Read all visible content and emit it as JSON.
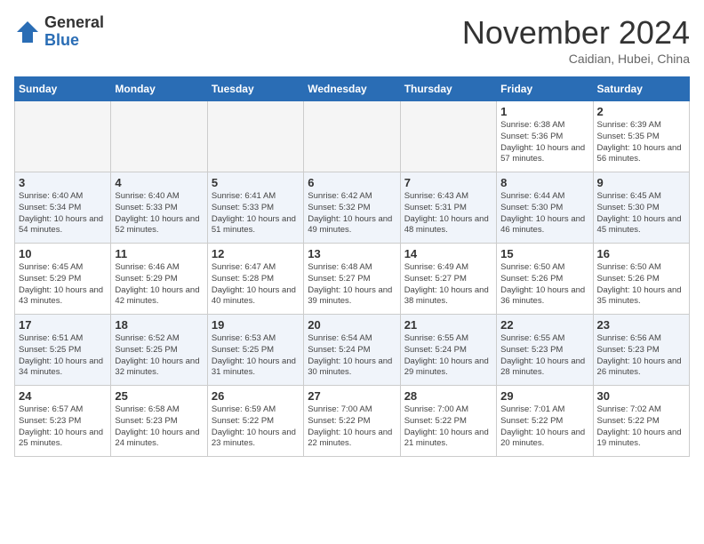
{
  "logo": {
    "general": "General",
    "blue": "Blue",
    "icon_color": "#2a6db5"
  },
  "header": {
    "month_year": "November 2024",
    "location": "Caidian, Hubei, China"
  },
  "weekdays": [
    "Sunday",
    "Monday",
    "Tuesday",
    "Wednesday",
    "Thursday",
    "Friday",
    "Saturday"
  ],
  "weeks": [
    [
      {
        "day": "",
        "empty": true
      },
      {
        "day": "",
        "empty": true
      },
      {
        "day": "",
        "empty": true
      },
      {
        "day": "",
        "empty": true
      },
      {
        "day": "",
        "empty": true
      },
      {
        "day": "1",
        "sunrise": "Sunrise: 6:38 AM",
        "sunset": "Sunset: 5:36 PM",
        "daylight": "Daylight: 10 hours and 57 minutes."
      },
      {
        "day": "2",
        "sunrise": "Sunrise: 6:39 AM",
        "sunset": "Sunset: 5:35 PM",
        "daylight": "Daylight: 10 hours and 56 minutes."
      }
    ],
    [
      {
        "day": "3",
        "sunrise": "Sunrise: 6:40 AM",
        "sunset": "Sunset: 5:34 PM",
        "daylight": "Daylight: 10 hours and 54 minutes."
      },
      {
        "day": "4",
        "sunrise": "Sunrise: 6:40 AM",
        "sunset": "Sunset: 5:33 PM",
        "daylight": "Daylight: 10 hours and 52 minutes."
      },
      {
        "day": "5",
        "sunrise": "Sunrise: 6:41 AM",
        "sunset": "Sunset: 5:33 PM",
        "daylight": "Daylight: 10 hours and 51 minutes."
      },
      {
        "day": "6",
        "sunrise": "Sunrise: 6:42 AM",
        "sunset": "Sunset: 5:32 PM",
        "daylight": "Daylight: 10 hours and 49 minutes."
      },
      {
        "day": "7",
        "sunrise": "Sunrise: 6:43 AM",
        "sunset": "Sunset: 5:31 PM",
        "daylight": "Daylight: 10 hours and 48 minutes."
      },
      {
        "day": "8",
        "sunrise": "Sunrise: 6:44 AM",
        "sunset": "Sunset: 5:30 PM",
        "daylight": "Daylight: 10 hours and 46 minutes."
      },
      {
        "day": "9",
        "sunrise": "Sunrise: 6:45 AM",
        "sunset": "Sunset: 5:30 PM",
        "daylight": "Daylight: 10 hours and 45 minutes."
      }
    ],
    [
      {
        "day": "10",
        "sunrise": "Sunrise: 6:45 AM",
        "sunset": "Sunset: 5:29 PM",
        "daylight": "Daylight: 10 hours and 43 minutes."
      },
      {
        "day": "11",
        "sunrise": "Sunrise: 6:46 AM",
        "sunset": "Sunset: 5:29 PM",
        "daylight": "Daylight: 10 hours and 42 minutes."
      },
      {
        "day": "12",
        "sunrise": "Sunrise: 6:47 AM",
        "sunset": "Sunset: 5:28 PM",
        "daylight": "Daylight: 10 hours and 40 minutes."
      },
      {
        "day": "13",
        "sunrise": "Sunrise: 6:48 AM",
        "sunset": "Sunset: 5:27 PM",
        "daylight": "Daylight: 10 hours and 39 minutes."
      },
      {
        "day": "14",
        "sunrise": "Sunrise: 6:49 AM",
        "sunset": "Sunset: 5:27 PM",
        "daylight": "Daylight: 10 hours and 38 minutes."
      },
      {
        "day": "15",
        "sunrise": "Sunrise: 6:50 AM",
        "sunset": "Sunset: 5:26 PM",
        "daylight": "Daylight: 10 hours and 36 minutes."
      },
      {
        "day": "16",
        "sunrise": "Sunrise: 6:50 AM",
        "sunset": "Sunset: 5:26 PM",
        "daylight": "Daylight: 10 hours and 35 minutes."
      }
    ],
    [
      {
        "day": "17",
        "sunrise": "Sunrise: 6:51 AM",
        "sunset": "Sunset: 5:25 PM",
        "daylight": "Daylight: 10 hours and 34 minutes."
      },
      {
        "day": "18",
        "sunrise": "Sunrise: 6:52 AM",
        "sunset": "Sunset: 5:25 PM",
        "daylight": "Daylight: 10 hours and 32 minutes."
      },
      {
        "day": "19",
        "sunrise": "Sunrise: 6:53 AM",
        "sunset": "Sunset: 5:25 PM",
        "daylight": "Daylight: 10 hours and 31 minutes."
      },
      {
        "day": "20",
        "sunrise": "Sunrise: 6:54 AM",
        "sunset": "Sunset: 5:24 PM",
        "daylight": "Daylight: 10 hours and 30 minutes."
      },
      {
        "day": "21",
        "sunrise": "Sunrise: 6:55 AM",
        "sunset": "Sunset: 5:24 PM",
        "daylight": "Daylight: 10 hours and 29 minutes."
      },
      {
        "day": "22",
        "sunrise": "Sunrise: 6:55 AM",
        "sunset": "Sunset: 5:23 PM",
        "daylight": "Daylight: 10 hours and 28 minutes."
      },
      {
        "day": "23",
        "sunrise": "Sunrise: 6:56 AM",
        "sunset": "Sunset: 5:23 PM",
        "daylight": "Daylight: 10 hours and 26 minutes."
      }
    ],
    [
      {
        "day": "24",
        "sunrise": "Sunrise: 6:57 AM",
        "sunset": "Sunset: 5:23 PM",
        "daylight": "Daylight: 10 hours and 25 minutes."
      },
      {
        "day": "25",
        "sunrise": "Sunrise: 6:58 AM",
        "sunset": "Sunset: 5:23 PM",
        "daylight": "Daylight: 10 hours and 24 minutes."
      },
      {
        "day": "26",
        "sunrise": "Sunrise: 6:59 AM",
        "sunset": "Sunset: 5:22 PM",
        "daylight": "Daylight: 10 hours and 23 minutes."
      },
      {
        "day": "27",
        "sunrise": "Sunrise: 7:00 AM",
        "sunset": "Sunset: 5:22 PM",
        "daylight": "Daylight: 10 hours and 22 minutes."
      },
      {
        "day": "28",
        "sunrise": "Sunrise: 7:00 AM",
        "sunset": "Sunset: 5:22 PM",
        "daylight": "Daylight: 10 hours and 21 minutes."
      },
      {
        "day": "29",
        "sunrise": "Sunrise: 7:01 AM",
        "sunset": "Sunset: 5:22 PM",
        "daylight": "Daylight: 10 hours and 20 minutes."
      },
      {
        "day": "30",
        "sunrise": "Sunrise: 7:02 AM",
        "sunset": "Sunset: 5:22 PM",
        "daylight": "Daylight: 10 hours and 19 minutes."
      }
    ]
  ]
}
